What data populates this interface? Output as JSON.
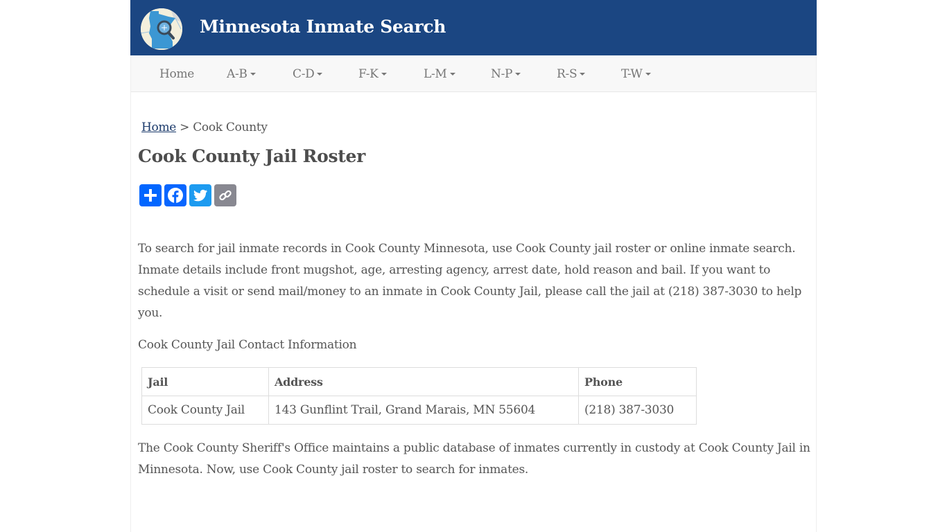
{
  "header": {
    "site_title": "Minnesota Inmate Search",
    "logo_icon": "minnesota-map-magnifier-logo"
  },
  "nav": {
    "items": [
      {
        "label": "Home",
        "dropdown": false
      },
      {
        "label": "A-B",
        "dropdown": true
      },
      {
        "label": "C-D",
        "dropdown": true
      },
      {
        "label": "F-K",
        "dropdown": true
      },
      {
        "label": "L-M",
        "dropdown": true
      },
      {
        "label": "N-P",
        "dropdown": true
      },
      {
        "label": "R-S",
        "dropdown": true
      },
      {
        "label": "T-W",
        "dropdown": true
      }
    ]
  },
  "breadcrumb": {
    "home": "Home",
    "separator": ">",
    "current": "Cook County"
  },
  "page_title": "Cook County Jail Roster",
  "share": {
    "buttons": [
      {
        "name": "share",
        "icon": "plus-icon",
        "color": "#0166ff"
      },
      {
        "name": "facebook",
        "icon": "facebook-icon",
        "color": "#0866ff"
      },
      {
        "name": "twitter",
        "icon": "twitter-icon",
        "color": "#1d9bf0"
      },
      {
        "name": "copy-link",
        "icon": "link-icon",
        "color": "#888891"
      }
    ]
  },
  "content": {
    "intro": "To search for jail inmate records in Cook County Minnesota, use Cook County jail roster or online inmate search. Inmate details include front mugshot, age, arresting agency, arrest date, hold reason and bail. If you want to schedule a visit or send mail/money to an inmate in Cook County Jail, please call the jail at (218) 387-3030 to help you.",
    "contact_heading": "Cook County Jail Contact Information",
    "table": {
      "headers": [
        "Jail",
        "Address",
        "Phone"
      ],
      "rows": [
        [
          "Cook County Jail",
          "143 Gunflint Trail, Grand Marais, MN 55604",
          "(218) 387-3030"
        ]
      ]
    },
    "closing": "The Cook County Sheriff's Office maintains a public database of inmates currently in custody at Cook County Jail in Minnesota. Now, use Cook County jail roster to search for inmates."
  },
  "colors": {
    "header_bg": "#1b4682",
    "nav_bg": "#f8f8f8",
    "text": "#555555",
    "link": "#1b3a6b"
  }
}
